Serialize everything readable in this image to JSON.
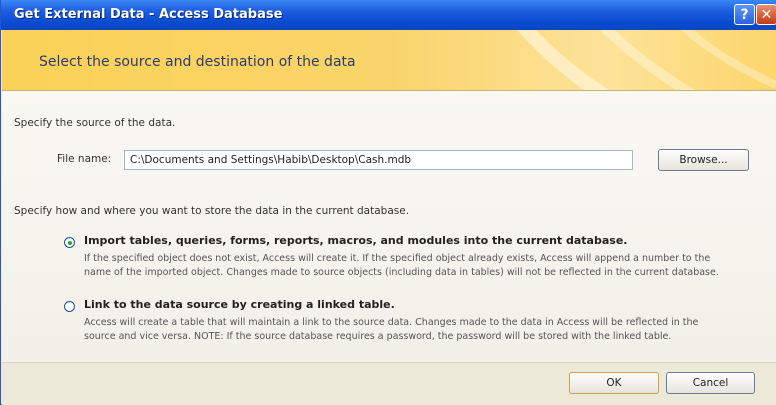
{
  "window": {
    "title": "Get External Data - Access Database",
    "help_glyph": "?",
    "close_glyph": "✕"
  },
  "header": {
    "title": "Select the source and destination of the data"
  },
  "source": {
    "intro": "Specify the source of the data.",
    "file_label": "File name:",
    "file_value": "C:\\Documents and Settings\\Habib\\Desktop\\Cash.mdb",
    "browse_label": "Browse..."
  },
  "store": {
    "intro": "Specify how and where you want to store the data in the current database.",
    "options": [
      {
        "label": "Import tables, queries, forms, reports, macros, and modules into the current database.",
        "selected": true,
        "desc_lines": [
          "If the specified object does not exist, Access will create it. If the specified object already exists, Access will append a number to the",
          "name of the imported object. Changes made to source objects (including data in tables) will not be reflected in the current database."
        ]
      },
      {
        "label": "Link to the data source by creating a linked table.",
        "selected": false,
        "desc_lines": [
          "Access will create a table that will maintain a link to the source data. Changes made to the data in Access will be reflected in the",
          "source and vice versa. NOTE:  If the source database requires a password, the password will be stored with the linked table."
        ]
      }
    ]
  },
  "footer": {
    "ok_label": "OK",
    "cancel_label": "Cancel"
  }
}
